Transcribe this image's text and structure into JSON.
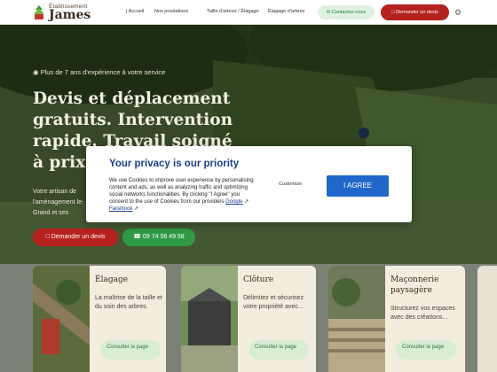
{
  "header": {
    "logo_top": "Établissement",
    "logo_name": "James",
    "nav": [
      {
        "label": "| Accueil"
      },
      {
        "label": "Nos prestations"
      },
      {
        "label": "Taille d'arbres / Élagage"
      },
      {
        "label": "Élagage d'arbres"
      }
    ],
    "contact_label": "Contactez-nous",
    "devis_label": "Demander un devis"
  },
  "hero": {
    "kicker": "Plus de 7 ans d'expérience à votre service",
    "title": "Devis et déplacement gratuits. Intervention rapide. Travail soigné à prix",
    "description": "Votre artisan de l'aménagement le-Grand et ses",
    "devis_button": "Demander un devis",
    "phone_button": "09 74 56 49 58"
  },
  "cards": [
    {
      "title": "Élagage",
      "text": "La maîtrise de la taille et du soin des arbres.",
      "button": "Consulter la page"
    },
    {
      "title": "Clôture",
      "text": "Délimitez et sécurisez votre propriété avec...",
      "button": "Consulter la page"
    },
    {
      "title": "Maçonnerie paysagère",
      "text": "Structurez vos espaces avec des créations...",
      "button": "Consulter la page"
    }
  ],
  "cookie": {
    "title": "Your privacy is our priority",
    "body": "We use Cookies to improve user experience by personalising content and ads, as well as analyzing traffic and optimizing social networks functionalities. By clicking \"I Agree\" you consent to the use of Cookies from our providers",
    "link_google": "Google",
    "link_facebook": "Facebook",
    "customize_label": "Customize",
    "agree_label": "I AGREE"
  },
  "colors": {
    "brand_red": "#b5221e",
    "brand_green": "#2f9a45",
    "cookie_blue": "#2167c9"
  }
}
